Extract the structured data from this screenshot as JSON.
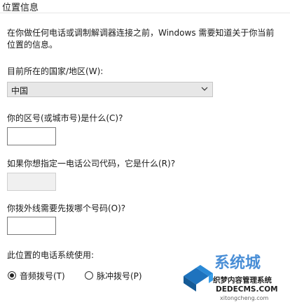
{
  "dialog": {
    "title": "位置信息",
    "intro_line1": "在你做任何电话或调制解调器连接之前，Windows 需要知道关于你当前",
    "intro_line2": "位置的信息。"
  },
  "country": {
    "label": "目前所在的国家/地区(W):",
    "selected": "中国"
  },
  "area_code": {
    "label": "你的区号(或城市号)是什么(C)?",
    "value": ""
  },
  "carrier_code": {
    "label": "如果你想指定一电话公司代码，它是什么(R)?",
    "value": ""
  },
  "outside_line": {
    "label": "你拨外线需要先拨哪个号码(O)?",
    "value": ""
  },
  "dialing": {
    "label": "此位置的电话系统使用:",
    "options": [
      {
        "label": "音频拨号(T)",
        "checked": true
      },
      {
        "label": "脉冲拨号(P)",
        "checked": false
      }
    ]
  },
  "watermark": {
    "brand_cn": "系统城",
    "site_cn": "织梦内容管理系统",
    "domain1": "DEDECMS.COM",
    "domain2": "xitongcheng.com"
  }
}
